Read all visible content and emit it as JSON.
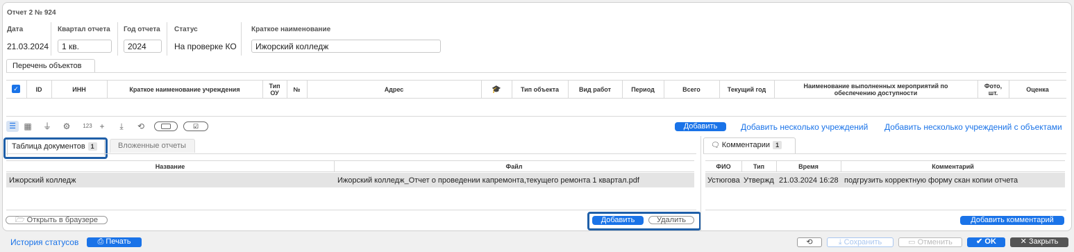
{
  "report": {
    "title": "Отчет 2 № 924",
    "fields": {
      "date_label": "Дата",
      "date_value": "21.03.2024",
      "quarter_label": "Квартал отчета",
      "quarter_value": "1 кв.",
      "year_label": "Год отчета",
      "year_value": "2024",
      "status_label": "Статус",
      "status_value": "На проверке КО",
      "short_name_label": "Краткое наименование",
      "short_name_value": "Ижорский колледж"
    }
  },
  "objects_tab": {
    "label": "Перечень объектов"
  },
  "objects_table": {
    "columns": [
      "ID",
      "ИНН",
      "Краткое наименование учреждения",
      "Тип ОУ",
      "№",
      "Адрес",
      "Тип объекта",
      "Вид работ",
      "Период",
      "Всего",
      "Текущий год",
      "Наименование выполненных мероприятий по обеспечению доступности",
      "Фото, шт.",
      "Оценка"
    ],
    "rows": []
  },
  "toolbar": {
    "number_label": "123",
    "add_button": "Добавить",
    "add_multiple_link": "Добавить несколько учреждений",
    "add_multiple_objects_link": "Добавить несколько учреждений с объектами"
  },
  "documents": {
    "tab_label": "Таблица документов",
    "tab_count": "1",
    "nested_tab_label": "Вложенные отчеты",
    "columns": [
      "Название",
      "Файл"
    ],
    "rows": [
      {
        "name": "Ижорский колледж",
        "file": "Ижорский колледж_Отчет о проведении капремонта,текущего ремонта  1 квартал.pdf"
      }
    ],
    "open_in_browser": "Открыть в браузере",
    "add_button": "Добавить",
    "delete_button": "Удалить"
  },
  "comments": {
    "tab_label": "Комментарии",
    "tab_count": "1",
    "columns": [
      "ФИО",
      "Тип",
      "Время",
      "Комментарий"
    ],
    "rows": [
      {
        "fio": "Устюгова",
        "type": "Утвержд",
        "time": "21.03.2024 16:28",
        "comment": "подгрузить корректную форму скан копии отчета"
      }
    ],
    "add_button": "Добавить комментарий"
  },
  "footer": {
    "history_link": "История статусов",
    "print_button": "Печать",
    "save_button": "Сохранить",
    "cancel_button": "Отменить",
    "ok_button": "OK",
    "close_button": "Закрыть"
  },
  "colors": {
    "accent": "#1a73e8",
    "highlight": "#1f5fa8",
    "row_selected": "#e4e4e4"
  }
}
